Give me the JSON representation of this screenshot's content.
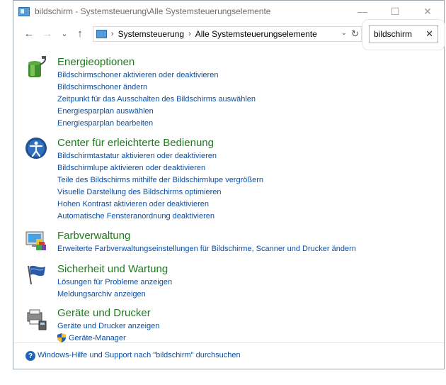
{
  "window": {
    "title": "bildschirm - Systemsteuerung\\Alle Systemsteuerungselemente",
    "minimize_glyph": "—",
    "maximize_glyph": "☐",
    "close_glyph": "✕"
  },
  "address": {
    "back_glyph": "←",
    "forward_glyph": "→",
    "recent_glyph": "⌄",
    "up_glyph": "↑",
    "sep_glyph": "›",
    "crumbs": [
      "Systemsteuerung",
      "Alle Systemsteuerungselemente"
    ],
    "dropdown_glyph": "⌄",
    "refresh_glyph": "↻"
  },
  "search": {
    "value": "bildschirm",
    "clear_glyph": "✕"
  },
  "groups": [
    {
      "title": "Energieoptionen",
      "icon": "power-options-icon",
      "links": [
        "Bildschirmschoner aktivieren oder deaktivieren",
        "Bildschirmschoner ändern",
        "Zeitpunkt für das Ausschalten des Bildschirms auswählen",
        "Energiesparplan auswählen",
        "Energiesparplan bearbeiten"
      ]
    },
    {
      "title": "Center für erleichterte Bedienung",
      "icon": "ease-of-access-icon",
      "links": [
        "Bildschirmtastatur aktivieren oder deaktivieren",
        "Bildschirmlupe aktivieren oder deaktivieren",
        "Teile des Bildschirms mithilfe der Bildschirmlupe vergrößern",
        "Visuelle Darstellung des Bildschirms optimieren",
        "Hohen Kontrast aktivieren oder deaktivieren",
        "Automatische Fensteranordnung deaktivieren"
      ]
    },
    {
      "title": "Farbverwaltung",
      "icon": "color-management-icon",
      "links": [
        "Erweiterte Farbverwaltungseinstellungen für Bildschirme, Scanner und Drucker ändern"
      ]
    },
    {
      "title": "Sicherheit und Wartung",
      "icon": "security-maintenance-flag-icon",
      "links": [
        "Lösungen für Probleme anzeigen",
        "Meldungsarchiv anzeigen"
      ]
    },
    {
      "title": "Geräte und Drucker",
      "icon": "devices-printers-icon",
      "links": [
        "Geräte und Drucker anzeigen",
        "Geräte-Manager"
      ]
    }
  ],
  "footer": {
    "help_glyph": "?",
    "help_link": "Windows-Hilfe und Support nach \"bildschirm\" durchsuchen"
  },
  "colors": {
    "group_title": "#1e7a1e",
    "link": "#0b4fa6",
    "window_border": "#9aa4ad"
  }
}
